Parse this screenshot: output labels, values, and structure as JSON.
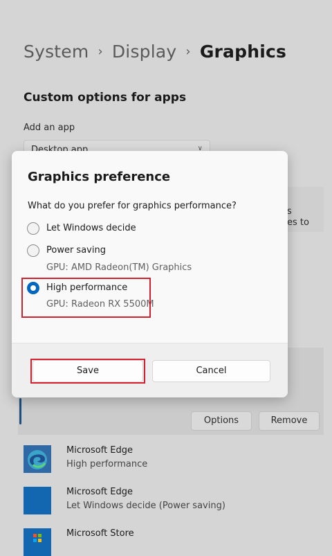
{
  "breadcrumb": {
    "part1": "System",
    "sep1": "›",
    "part2": "Display",
    "sep2": "›",
    "current": "Graphics"
  },
  "section_title": "Custom options for apps",
  "add_app": {
    "label": "Add an app",
    "selected": "Desktop app"
  },
  "background_text": {
    "line1": "s",
    "line2": "es to"
  },
  "app_buttons": {
    "options": "Options",
    "remove": "Remove"
  },
  "dialog": {
    "title": "Graphics preference",
    "question": "What do you prefer for graphics performance?",
    "options": [
      {
        "label": "Let Windows decide",
        "sub": ""
      },
      {
        "label": "Power saving",
        "sub": "GPU: AMD Radeon(TM) Graphics"
      },
      {
        "label": "High performance",
        "sub": "GPU: Radeon RX 5500M"
      }
    ],
    "selected_index": 2,
    "save": "Save",
    "cancel": "Cancel"
  },
  "apps": [
    {
      "name": "Microsoft Edge",
      "setting": "High performance",
      "icon": "edge-icon"
    },
    {
      "name": "Microsoft Edge",
      "setting": "Let Windows decide (Power saving)",
      "icon": "app-placeholder-icon"
    },
    {
      "name": "Microsoft Store",
      "setting": "",
      "icon": "store-icon"
    }
  ],
  "colors": {
    "accent": "#0067c0",
    "highlight": "#d3202e",
    "overlay": "#d5d5d5"
  }
}
